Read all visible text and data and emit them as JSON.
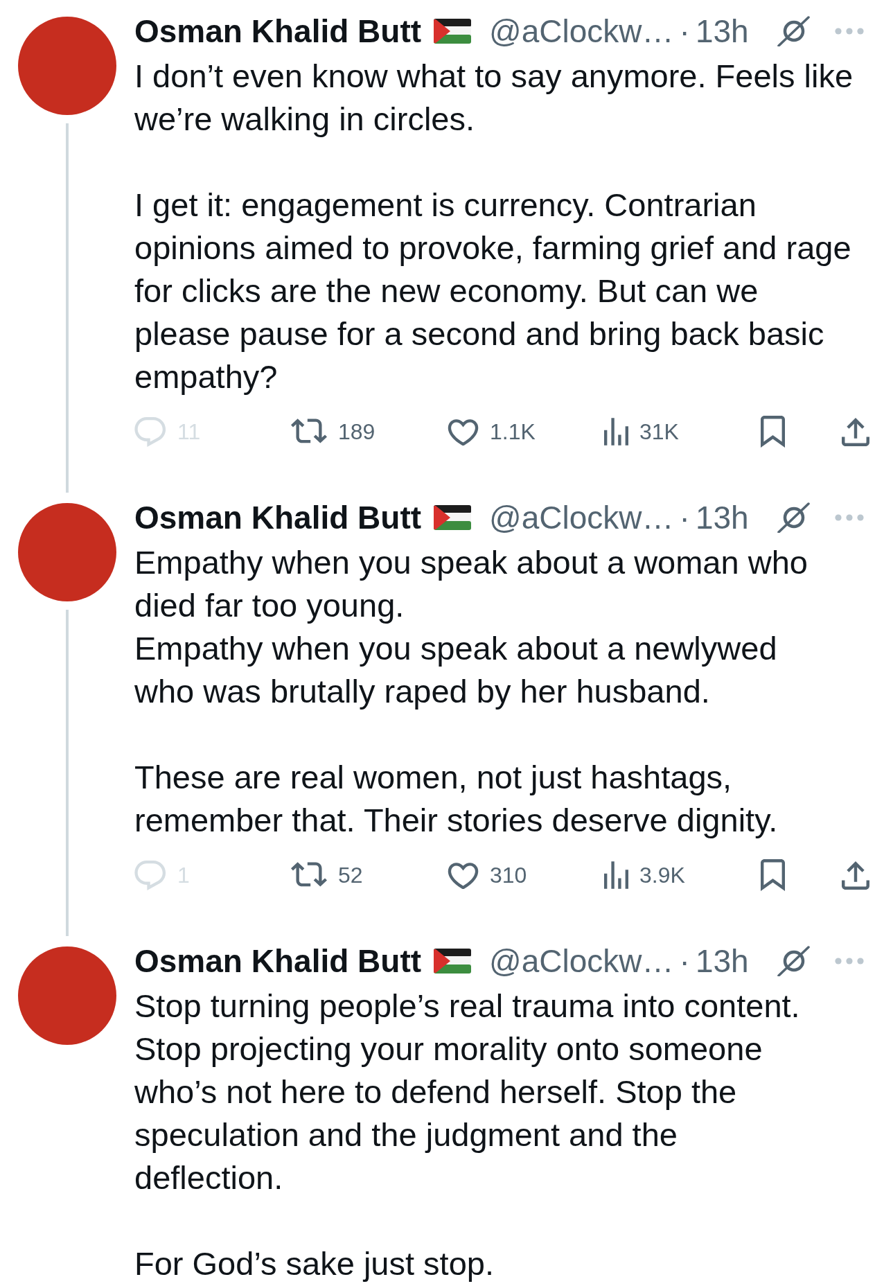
{
  "tweets": [
    {
      "author": {
        "name": "Osman Khalid Butt",
        "handle": "@aClockw…",
        "separator": "·",
        "time": "13h"
      },
      "paragraphs": [
        [
          "I don’t even know what to say anymore. Feels like",
          "we’re walking in circles."
        ],
        [
          "I get it: engagement is currency. Contrarian",
          "opinions aimed to provoke, farming grief and rage",
          "for clicks are the new economy. But can we",
          "please pause for a second and bring back basic",
          "empathy?"
        ]
      ],
      "actions": [
        {
          "kind": "reply",
          "count": "11",
          "disabled": true
        },
        {
          "kind": "repost",
          "count": "189",
          "disabled": false
        },
        {
          "kind": "like",
          "count": "1.1K",
          "disabled": false
        },
        {
          "kind": "views",
          "count": "31K",
          "disabled": false
        },
        {
          "kind": "bookmark",
          "disabled": false
        },
        {
          "kind": "share",
          "disabled": false
        }
      ]
    },
    {
      "author": {
        "name": "Osman Khalid Butt",
        "handle": "@aClockw…",
        "separator": "·",
        "time": "13h"
      },
      "paragraphs": [
        [
          "Empathy when you speak about a woman who",
          "died far too young.",
          "Empathy when you speak about a newlywed",
          "who was brutally raped by her husband."
        ],
        [
          "These are real women, not just hashtags,",
          "remember that. Their stories deserve dignity."
        ]
      ],
      "actions": [
        {
          "kind": "reply",
          "count": "1",
          "disabled": true
        },
        {
          "kind": "repost",
          "count": "52",
          "disabled": false
        },
        {
          "kind": "like",
          "count": "310",
          "disabled": false
        },
        {
          "kind": "views",
          "count": "3.9K",
          "disabled": false
        },
        {
          "kind": "bookmark",
          "disabled": false
        },
        {
          "kind": "share",
          "disabled": false
        }
      ]
    },
    {
      "author": {
        "name": "Osman Khalid Butt",
        "handle": "@aClockw…",
        "separator": "·",
        "time": "13h"
      },
      "paragraphs": [
        [
          "Stop turning people’s real trauma into content.",
          "Stop projecting your morality onto someone",
          "who’s not here to defend herself. Stop the",
          "speculation and the judgment and the",
          "deflection."
        ],
        [
          "For God’s sake just stop."
        ]
      ]
    }
  ]
}
